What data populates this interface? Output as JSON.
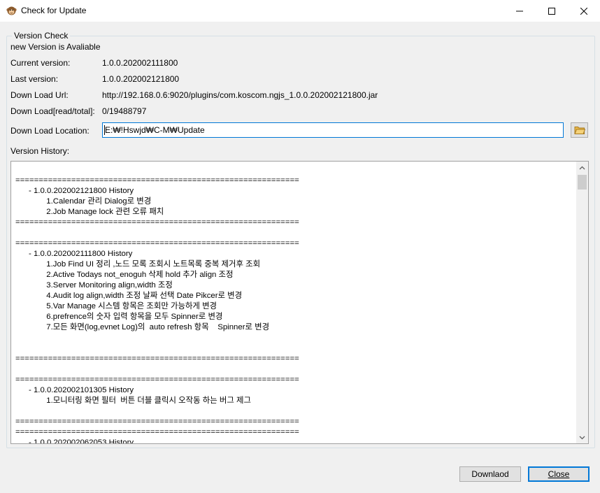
{
  "window": {
    "title": "Check for Update",
    "icon": "monkey-app-icon",
    "controls": [
      "minimize-icon",
      "maximize-icon",
      "close-icon"
    ]
  },
  "version_check": {
    "group_title": "Version Check",
    "notice": "new  Version is Avaliable",
    "current_version_label": "Current version:",
    "current_version": "1.0.0.202002111800",
    "last_version_label": "Last  version:",
    "last_version": "1.0.0.202002121800",
    "download_url_label": "Down Load Url:",
    "download_url": "http://192.168.0.6:9020/plugins/com.koscom.ngjs_1.0.0.202002121800.jar",
    "download_progress_label": "Down Load[read/total]:",
    "download_progress": "0/19488797",
    "download_location_label": "Down Load Location:",
    "download_location": "E:₩!Hswjd₩C-M₩Update",
    "browse_icon": "folder-icon",
    "version_history_label": "Version History:",
    "version_history": "=============================================================\n      - 1.0.0.202002121800 History\n              1.Calendar 관리 Dialog로 변경\n              2.Job Manage lock 관련 오류 패치\n=============================================================\n\n=============================================================\n      - 1.0.0.202002111800 History\n              1.Job Find UI 정리 ,노드 모록 조회시 노트목록 중복 제거후 조회\n              2.Active Todays not_enoguh 삭제 hold 추가 align 조정\n              3.Server Monitoring align,width 조정\n              4.Audit log align,width 조정 날짜 선택 Date Pikcer로 변경\n              5.Var Manage 시스템 항목은 조회만 가능하게 변경\n              6.prefrence의 숫자 입력 항목을 모두 Spinner로 변경\n              7.모든 화면(log,evnet Log)의  auto refresh 항목    Spinner로 변경\n\n\n=============================================================\n\n=============================================================\n      - 1.0.0.202002101305 History\n              1.모니터링 화면 필터  버튼 더블 클릭시 오작동 하는 버그 제그\n\n=============================================================\n=============================================================\n      - 1.0.0.202002062053 History"
  },
  "buttons": {
    "download_label": "Downlaod",
    "close_label": "Close"
  }
}
